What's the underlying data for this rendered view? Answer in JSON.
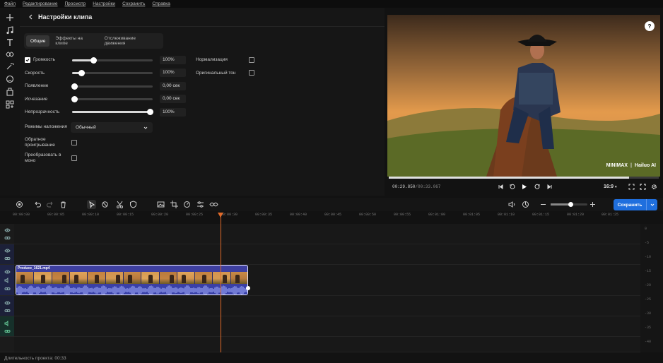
{
  "menu": [
    "Файл",
    "Редактирование",
    "Просмотр",
    "Настройки",
    "Сохранить",
    "Справка"
  ],
  "panel": {
    "title": "Настройки клипа",
    "tabs": [
      "Общие",
      "Эффекты на клипе",
      "Отслеживание движения"
    ],
    "volume": {
      "label": "Громкость",
      "value": "100%",
      "checked": true,
      "level": 0.27
    },
    "speed": {
      "label": "Скорость",
      "value": "100%",
      "level": 0.12
    },
    "fade_in": {
      "label": "Появление",
      "value": "0,00 сек",
      "level": 0
    },
    "fade_out": {
      "label": "Исчезание",
      "value": "0,00 сек",
      "level": 0
    },
    "opacity": {
      "label": "Непрозрачность",
      "value": "100%",
      "level": 1
    },
    "blend": {
      "label": "Режимы наложения",
      "value": "Обычный"
    },
    "reverse": {
      "label_1": "Обратное",
      "label_2": "проигрывание"
    },
    "mono": {
      "label_1": "Преобразовать в",
      "label_2": "моно"
    },
    "normalize": {
      "label": "Нормализация"
    },
    "original_tone": {
      "label": "Оригинальный тон"
    }
  },
  "preview": {
    "watermark_brand1": "MINIMAX",
    "watermark_brand2": "Hailuo AI",
    "time_current": "00:29.850",
    "time_total": "/00:33.067",
    "progress": 0.89,
    "aspect": "16:9"
  },
  "timeline": {
    "save_label": "Сохранить",
    "ruler": [
      "00:00:00",
      "00:00:05",
      "00:00:10",
      "00:00:15",
      "00:00:20",
      "00:00:25",
      "00:00:30",
      "00:00:35",
      "00:00:40",
      "00:00:45",
      "00:00:50",
      "00:00:55",
      "00:01:00",
      "00:01:05",
      "00:01:10",
      "00:01:15",
      "00:01:20",
      "00:01:25"
    ],
    "clip_name": "Produce_1621.mp4",
    "meter_ticks": [
      "0",
      "-5",
      "-10",
      "-15",
      "-20",
      "-25",
      "-30",
      "-35",
      "-40"
    ],
    "zoom_level": 0.55
  },
  "footer": {
    "duration": "Длительность проекта: 00:33"
  },
  "colors": {
    "accent": "#1f6fde",
    "playhead": "#e06a2a",
    "clip": "#3e3fa0"
  }
}
